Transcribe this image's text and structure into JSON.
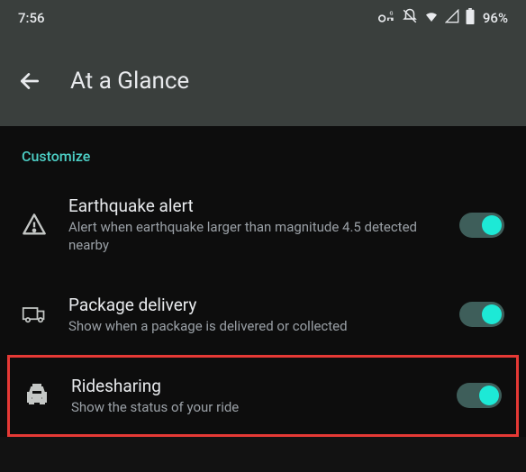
{
  "statusBar": {
    "time": "7:56",
    "battery": "96%"
  },
  "header": {
    "title": "At a Glance"
  },
  "sectionLabel": "Customize",
  "settings": [
    {
      "title": "Earthquake alert",
      "subtitle": "Alert when earthquake larger than magnitude 4.5 detected nearby",
      "enabled": true
    },
    {
      "title": "Package delivery",
      "subtitle": "Show when a package is delivered or collected",
      "enabled": true
    },
    {
      "title": "Ridesharing",
      "subtitle": "Show the status of your ride",
      "enabled": true
    }
  ]
}
